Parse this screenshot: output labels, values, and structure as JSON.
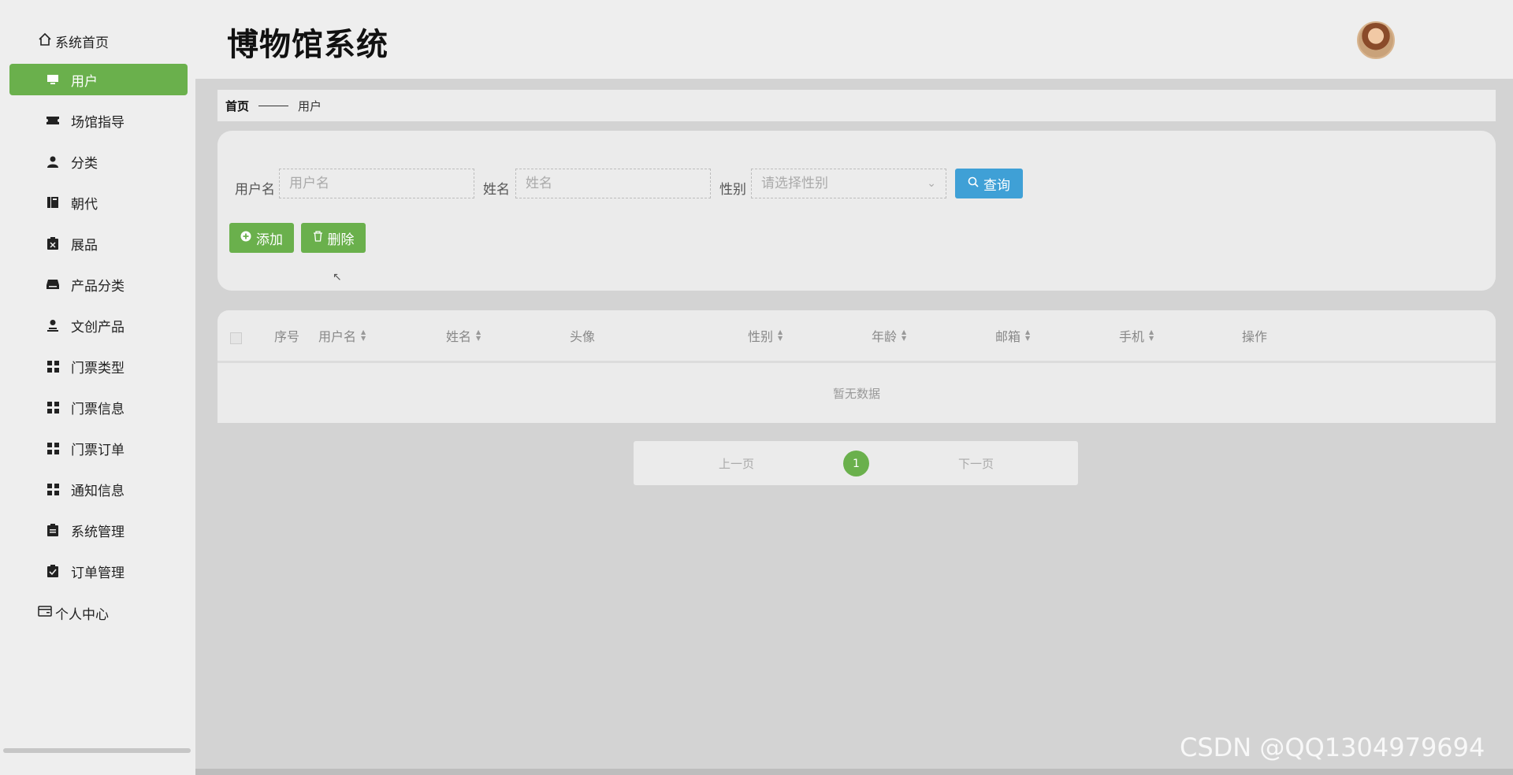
{
  "sidebar": {
    "home": {
      "label": "系统首页",
      "icon": "home-icon"
    },
    "items": [
      {
        "label": "用户",
        "icon": "monitor-icon",
        "active": true
      },
      {
        "label": "场馆指导",
        "icon": "ticket-icon"
      },
      {
        "label": "分类",
        "icon": "user-icon"
      },
      {
        "label": "朝代",
        "icon": "book-icon"
      },
      {
        "label": "展品",
        "icon": "clipboard-x-icon"
      },
      {
        "label": "产品分类",
        "icon": "inbox-icon"
      },
      {
        "label": "文创产品",
        "icon": "user-stand-icon"
      },
      {
        "label": "门票类型",
        "icon": "grid-icon"
      },
      {
        "label": "门票信息",
        "icon": "grid-icon"
      },
      {
        "label": "门票订单",
        "icon": "grid-icon"
      },
      {
        "label": "通知信息",
        "icon": "grid-icon"
      },
      {
        "label": "系统管理",
        "icon": "clipboard-list-icon"
      },
      {
        "label": "订单管理",
        "icon": "clipboard-check-icon"
      }
    ],
    "personal": {
      "label": "个人中心",
      "icon": "card-icon"
    }
  },
  "header": {
    "title": "博物馆系统",
    "avatar": "user-avatar"
  },
  "breadcrumb": {
    "home": "首页",
    "current": "用户"
  },
  "search": {
    "username_label": "用户名",
    "username_placeholder": "用户名",
    "name_label": "姓名",
    "name_placeholder": "姓名",
    "gender_label": "性别",
    "gender_placeholder": "请选择性别",
    "query_label": "查询",
    "add_label": "添加",
    "delete_label": "删除"
  },
  "table": {
    "columns": [
      {
        "label": "序号",
        "sortable": false
      },
      {
        "label": "用户名",
        "sortable": true
      },
      {
        "label": "姓名",
        "sortable": true
      },
      {
        "label": "头像",
        "sortable": false
      },
      {
        "label": "性别",
        "sortable": true
      },
      {
        "label": "年龄",
        "sortable": true
      },
      {
        "label": "邮箱",
        "sortable": true
      },
      {
        "label": "手机",
        "sortable": true
      },
      {
        "label": "操作",
        "sortable": false
      }
    ],
    "empty_text": "暂无数据"
  },
  "pagination": {
    "prev": "上一页",
    "current": "1",
    "next": "下一页"
  },
  "watermark": "CSDN @QQ1304979694",
  "colors": {
    "accent_green": "#6ab04c",
    "query_blue": "#3fa0d6"
  }
}
